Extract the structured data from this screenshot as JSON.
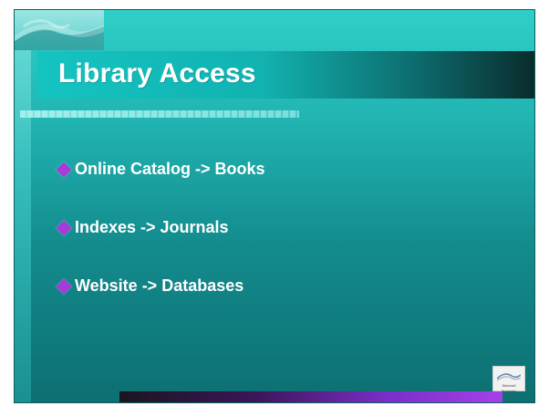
{
  "slide": {
    "title": "Library Access",
    "bullets": [
      {
        "text": "Online Catalog -> Books"
      },
      {
        "text": "Indexes -> Journals"
      },
      {
        "text": "Website -> Databases"
      }
    ],
    "badge_caption": "Informed Strategies"
  },
  "colors": {
    "bullet": "#a73bd9",
    "title_text": "#ffffff"
  },
  "icons": {
    "top_left_logo": "waves-logo-icon",
    "bottom_right_logo": "waves-badge-icon"
  }
}
